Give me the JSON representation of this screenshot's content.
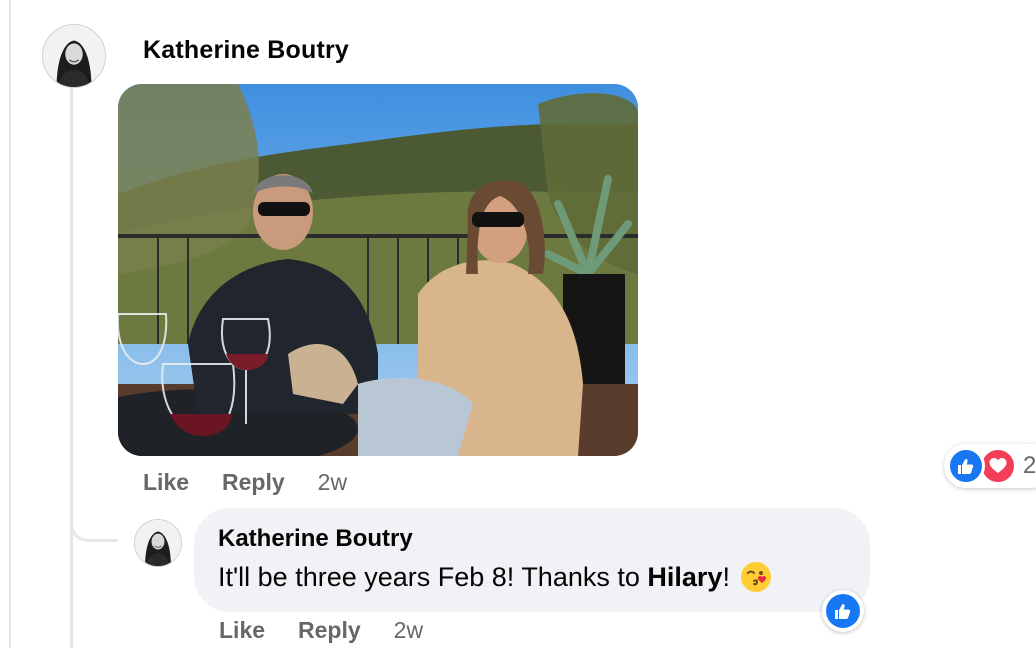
{
  "comment": {
    "author": "Katherine Boutry",
    "avatar_icon": "profile-photo-avatar",
    "photo_icon": "attached-photo",
    "actions": {
      "like_label": "Like",
      "reply_label": "Reply",
      "timestamp": "2w"
    },
    "reactions": {
      "icons": [
        "like-reaction-icon",
        "love-reaction-icon"
      ],
      "count": "2"
    }
  },
  "reply": {
    "author": "Katherine Boutry",
    "text_before": "It'll be three years Feb 8! Thanks to ",
    "mention": "Hilary",
    "text_after": "!",
    "emoji": "face-blowing-kiss-emoji",
    "reaction_icon": "like-reaction-icon",
    "actions": {
      "like_label": "Like",
      "reply_label": "Reply",
      "timestamp": "2w"
    }
  },
  "colors": {
    "brand_blue": "#1877f2",
    "love_red": "#f33e58",
    "bubble_bg": "#f0f2f5",
    "secondary_text": "#65676b"
  }
}
